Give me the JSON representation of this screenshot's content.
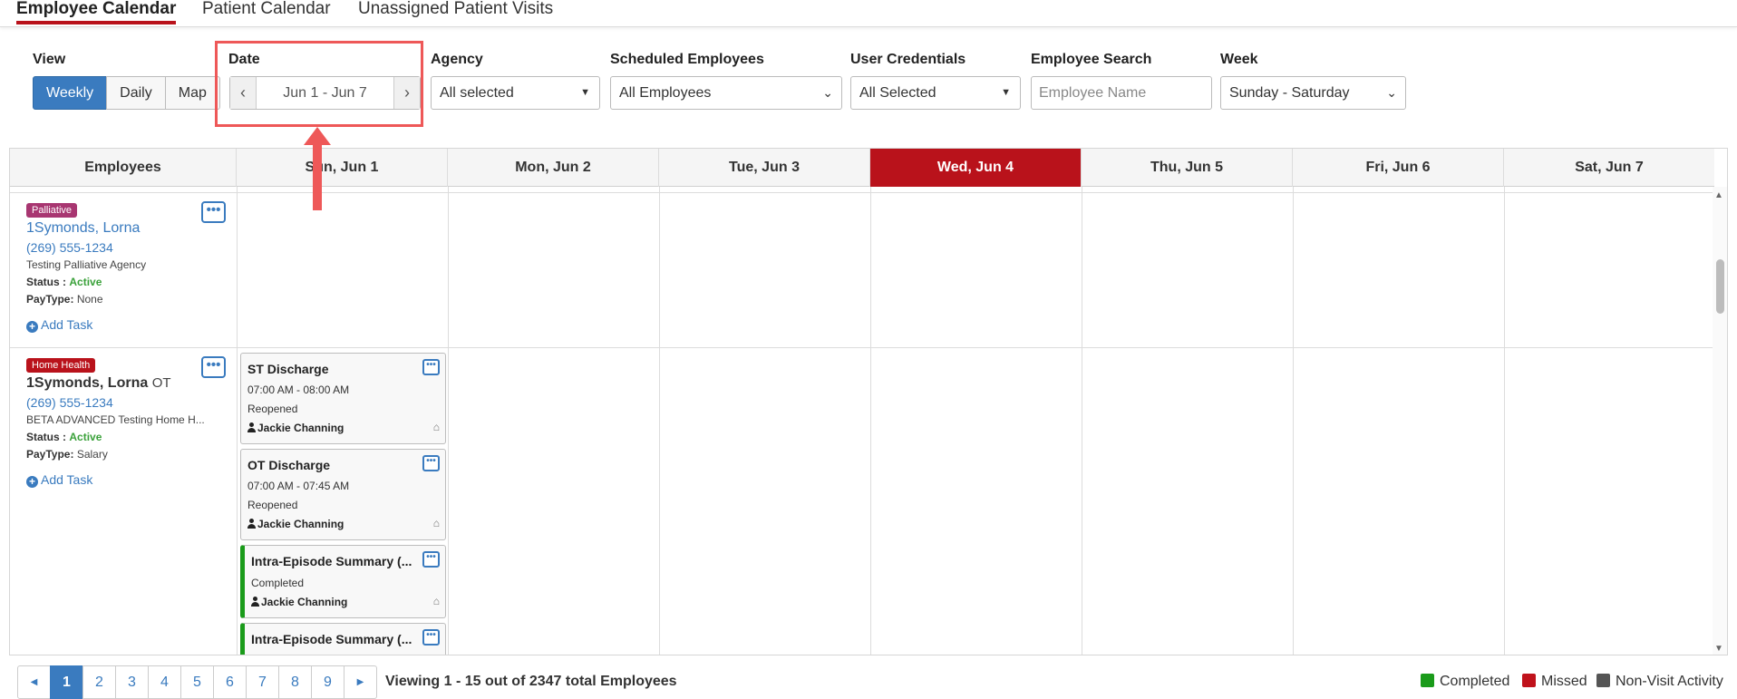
{
  "tabs": [
    {
      "label": "Employee Calendar",
      "active": true
    },
    {
      "label": "Patient Calendar",
      "active": false
    },
    {
      "label": "Unassigned Patient Visits",
      "active": false
    }
  ],
  "filters": {
    "view": {
      "label": "View",
      "options": [
        "Weekly",
        "Daily",
        "Map"
      ],
      "selected": "Weekly"
    },
    "date": {
      "label": "Date",
      "value": "Jun 1 - Jun 7"
    },
    "agency": {
      "label": "Agency",
      "value": "All selected"
    },
    "scheduled": {
      "label": "Scheduled Employees",
      "value": "All Employees"
    },
    "credentials": {
      "label": "User Credentials",
      "value": "All Selected"
    },
    "search": {
      "label": "Employee Search",
      "placeholder": "Employee Name",
      "value": ""
    },
    "week": {
      "label": "Week",
      "value": "Sunday - Saturday"
    }
  },
  "calendar": {
    "employees_header": "Employees",
    "days": [
      "Sun, Jun 1",
      "Mon, Jun 2",
      "Tue, Jun 3",
      "Wed, Jun 4",
      "Thu, Jun 5",
      "Fri, Jun 6",
      "Sat, Jun 7"
    ],
    "today": "Wed, Jun 4",
    "today_color": "#b9121b"
  },
  "employees": [
    {
      "badge": "Palliative",
      "badge_color": "#a83671",
      "name": "1Symonds, Lorna",
      "credential": "",
      "phone": "(269) 555-1234",
      "agency": "Testing Palliative Agency",
      "status_label": "Status :",
      "status": "Active",
      "paytype_label": "PayType:",
      "paytype": "None",
      "add_task": "Add Task"
    },
    {
      "badge": "Home Health",
      "badge_color": "#b9121b",
      "name": "1Symonds, Lorna",
      "credential": "OT",
      "phone": "(269) 555-1234",
      "agency": "BETA ADVANCED Testing Home H...",
      "status_label": "Status :",
      "status": "Active",
      "paytype_label": "PayType:",
      "paytype": "Salary",
      "add_task": "Add Task"
    }
  ],
  "tasks": [
    {
      "title": "ST Discharge",
      "time": "07:00 AM - 08:00 AM",
      "status": "Reopened",
      "assignee": "Jackie Channing",
      "completed": false
    },
    {
      "title": "OT Discharge",
      "time": "07:00 AM - 07:45 AM",
      "status": "Reopened",
      "assignee": "Jackie Channing",
      "completed": false
    },
    {
      "title": "Intra-Episode Summary (...",
      "time": "",
      "status": "Completed",
      "assignee": "Jackie Channing",
      "completed": true
    },
    {
      "title": "Intra-Episode Summary (...",
      "time": "",
      "status": "",
      "assignee": "",
      "completed": true
    }
  ],
  "pagination": {
    "pages": [
      "1",
      "2",
      "3",
      "4",
      "5",
      "6",
      "7",
      "8",
      "9"
    ],
    "current": "1",
    "viewing": "Viewing 1 - 15 out of 2347 total Employees"
  },
  "legend": [
    {
      "label": "Completed",
      "color": "#1a9b1a"
    },
    {
      "label": "Missed",
      "color": "#c0121b"
    },
    {
      "label": "Non-Visit Activity",
      "color": "#555555"
    }
  ],
  "annotation_color": "#ee5858"
}
